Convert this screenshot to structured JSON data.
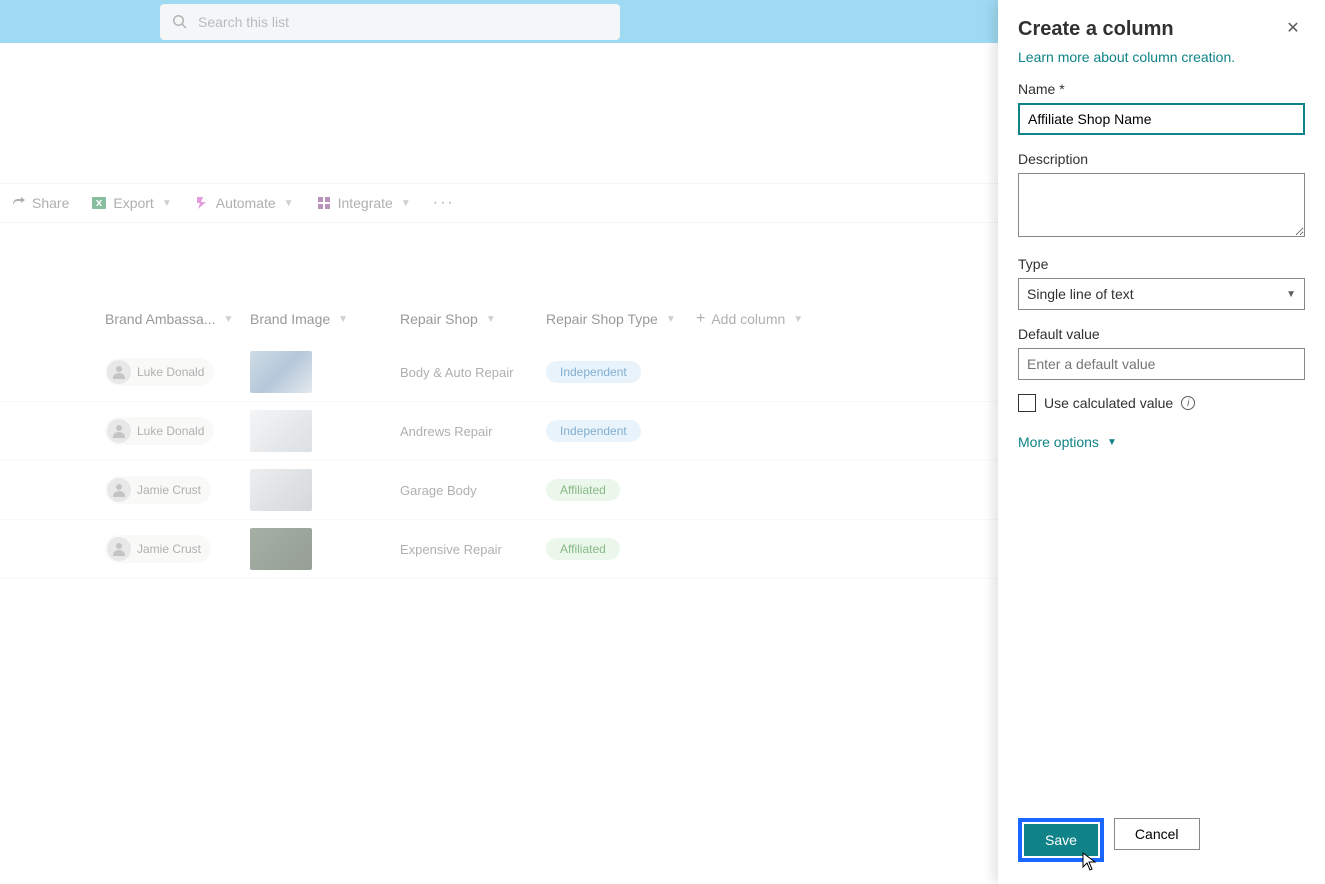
{
  "search": {
    "placeholder": "Search this list"
  },
  "toolbar": {
    "share": "Share",
    "export": "Export",
    "automate": "Automate",
    "integrate": "Integrate"
  },
  "columns": {
    "brand_ambassador": "Brand Ambassa...",
    "brand_image": "Brand Image",
    "repair_shop": "Repair Shop",
    "repair_shop_type": "Repair Shop Type",
    "add_column": "Add column"
  },
  "rows": [
    {
      "person": "Luke Donald",
      "shop": "Body & Auto Repair",
      "type": "Independent",
      "badge": "blue"
    },
    {
      "person": "Luke Donald",
      "shop": "Andrews Repair",
      "type": "Independent",
      "badge": "blue"
    },
    {
      "person": "Jamie Crust",
      "shop": "Garage Body",
      "type": "Affiliated",
      "badge": "green"
    },
    {
      "person": "Jamie Crust",
      "shop": "Expensive Repair",
      "type": "Affiliated",
      "badge": "green"
    }
  ],
  "panel": {
    "title": "Create a column",
    "learn_more": "Learn more about column creation.",
    "name_label": "Name *",
    "name_value": "Affiliate Shop Name",
    "description_label": "Description",
    "description_value": "",
    "type_label": "Type",
    "type_value": "Single line of text",
    "default_label": "Default value",
    "default_placeholder": "Enter a default value",
    "use_calculated": "Use calculated value",
    "more_options": "More options",
    "save": "Save",
    "cancel": "Cancel"
  }
}
